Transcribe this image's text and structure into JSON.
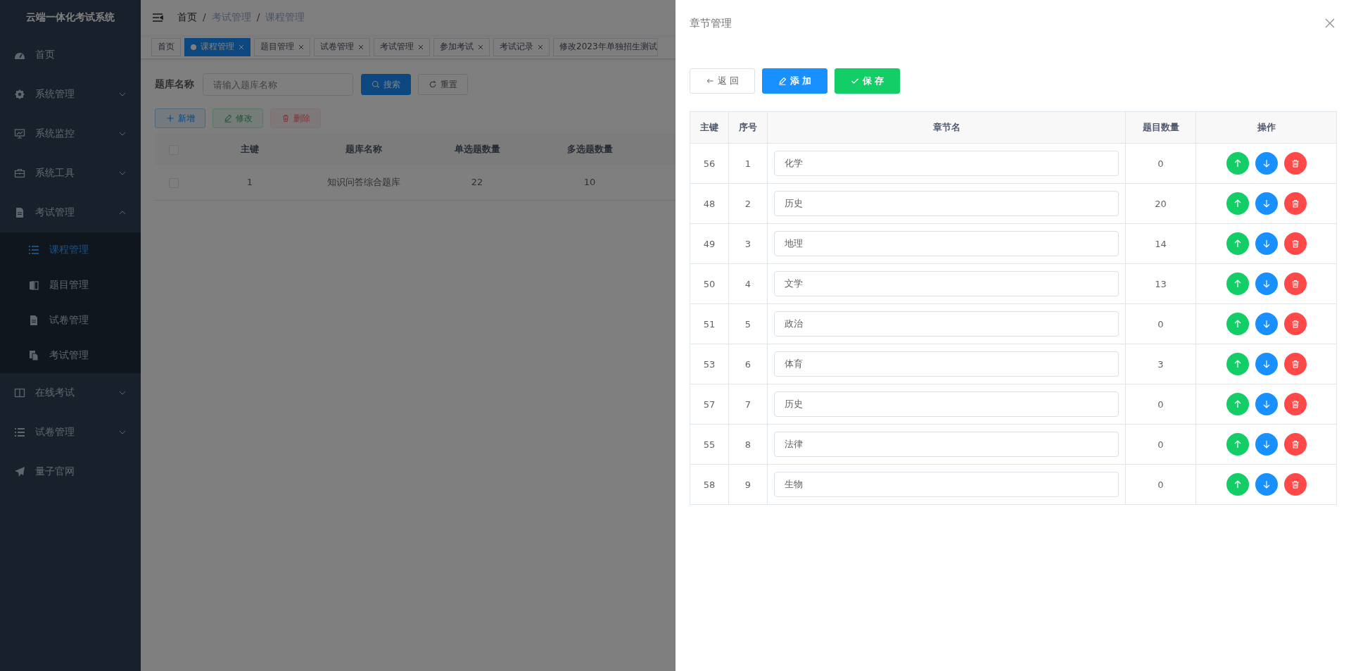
{
  "sidebar": {
    "title": "云端一体化考试系统",
    "items": [
      {
        "label": "首页",
        "selected": false
      },
      {
        "label": "系统管理",
        "selected": false,
        "expanded": false
      },
      {
        "label": "系统监控",
        "selected": false,
        "expanded": false
      },
      {
        "label": "系统工具",
        "selected": false,
        "expanded": false
      },
      {
        "label": "考试管理",
        "selected": false,
        "expanded": true,
        "children": [
          {
            "label": "课程管理",
            "selected": true
          },
          {
            "label": "题目管理",
            "selected": false
          },
          {
            "label": "试卷管理",
            "selected": false
          },
          {
            "label": "考试管理",
            "selected": false
          }
        ]
      },
      {
        "label": "在线考试",
        "selected": false,
        "expanded": false
      },
      {
        "label": "试卷管理",
        "selected": false,
        "expanded": false
      },
      {
        "label": "量子官网",
        "selected": false
      }
    ]
  },
  "breadcrumb": {
    "separator": "/",
    "items": [
      "首页",
      "考试管理",
      "课程管理"
    ]
  },
  "tags": [
    {
      "label": "首页",
      "selected": false,
      "closable": false
    },
    {
      "label": "课程管理",
      "selected": true,
      "closable": true
    },
    {
      "label": "题目管理",
      "selected": false,
      "closable": true
    },
    {
      "label": "试卷管理",
      "selected": false,
      "closable": true
    },
    {
      "label": "考试管理",
      "selected": false,
      "closable": true
    },
    {
      "label": "参加考试",
      "selected": false,
      "closable": true
    },
    {
      "label": "考试记录",
      "selected": false,
      "closable": true
    },
    {
      "label": "修改2023年单独招生测试",
      "selected": false,
      "closable": false
    }
  ],
  "search": {
    "label": "题库名称",
    "placeholder": "请输入题库名称",
    "buttons": [
      {
        "kind": "primary",
        "label": "搜索"
      },
      {
        "kind": "plain",
        "label": "重置"
      }
    ]
  },
  "toolbar": [
    {
      "kind": "add",
      "label": "新增",
      "disabled": false
    },
    {
      "kind": "edit",
      "label": "修改",
      "disabled": true
    },
    {
      "kind": "delete",
      "label": "删除",
      "disabled": true
    }
  ],
  "table": {
    "all_checked": false,
    "columns": [
      "主键",
      "题库名称",
      "单选题数量",
      "多选题数量"
    ],
    "rows": [
      {
        "checked": false,
        "cells": [
          "1",
          "知识问答综合题库",
          "22",
          "10"
        ]
      }
    ]
  },
  "drawer": {
    "title": "章节管理",
    "buttons": [
      {
        "kind": "back",
        "label": "返 回"
      },
      {
        "kind": "add",
        "label": "添 加"
      },
      {
        "kind": "save",
        "label": "保 存"
      }
    ],
    "columns": [
      "主键",
      "序号",
      "章节名",
      "题目数量",
      "操作"
    ],
    "rows": [
      {
        "id": "56",
        "order": "1",
        "name": "化学",
        "count": "0"
      },
      {
        "id": "48",
        "order": "2",
        "name": "历史",
        "count": "20"
      },
      {
        "id": "49",
        "order": "3",
        "name": "地理",
        "count": "14"
      },
      {
        "id": "50",
        "order": "4",
        "name": "文学",
        "count": "13"
      },
      {
        "id": "51",
        "order": "5",
        "name": "政治",
        "count": "0"
      },
      {
        "id": "53",
        "order": "6",
        "name": "体育",
        "count": "3"
      },
      {
        "id": "57",
        "order": "7",
        "name": "历史",
        "count": "0"
      },
      {
        "id": "55",
        "order": "8",
        "name": "法律",
        "count": "0"
      },
      {
        "id": "58",
        "order": "9",
        "name": "生物",
        "count": "0"
      }
    ]
  }
}
